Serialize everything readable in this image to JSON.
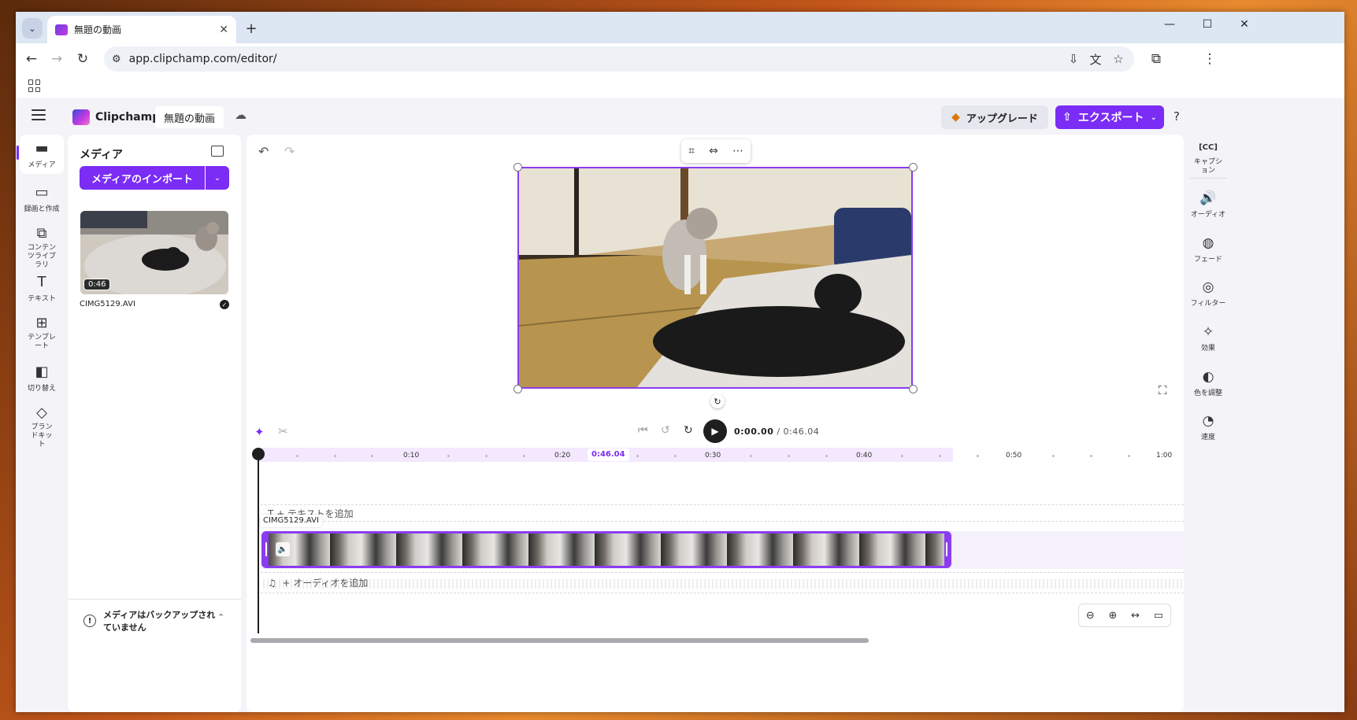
{
  "browser": {
    "tab_title": "無題の動画",
    "url": "app.clipchamp.com/editor/"
  },
  "app": {
    "brand": "Clipchamp",
    "project_name": "無題の動画",
    "upgrade_label": "アップグレード",
    "export_label": "エクスポート"
  },
  "left_rail": [
    {
      "label": "メディア",
      "icon": "folder-icon"
    },
    {
      "label": "録画と作成",
      "icon": "video-camera-icon"
    },
    {
      "label": "コンテンツライブラリ",
      "icon": "library-icon"
    },
    {
      "label": "テキスト",
      "icon": "text-icon"
    },
    {
      "label": "テンプレート",
      "icon": "template-icon"
    },
    {
      "label": "切り替え",
      "icon": "transition-icon"
    },
    {
      "label": "ブランドキット",
      "icon": "brand-kit-icon"
    }
  ],
  "media": {
    "title": "メディア",
    "import_label": "メディアのインポート",
    "item": {
      "duration": "0:46",
      "filename": "CIMG5129.AVI"
    },
    "backup_text": "メディアはバックアップされていません"
  },
  "player": {
    "current_time": "0:00.00",
    "total_time": "/ 0:46.04"
  },
  "timeline": {
    "ticks": [
      "0:10",
      "0:20",
      "0:30",
      "0:40",
      "0:50",
      "1:00"
    ],
    "current_marker": "0:46.04",
    "text_track_label": "T + テキストを追加",
    "clip_label": "CIMG5129.AVI",
    "audio_track_label": "+ オーディオを追加"
  },
  "right_rail": [
    {
      "label": "キャプション",
      "icon": "captions-icon"
    },
    {
      "label": "オーディオ",
      "icon": "speaker-icon"
    },
    {
      "label": "フェード",
      "icon": "fade-icon"
    },
    {
      "label": "フィルター",
      "icon": "filter-icon"
    },
    {
      "label": "効果",
      "icon": "magic-wand-icon"
    },
    {
      "label": "色を調整",
      "icon": "contrast-icon"
    },
    {
      "label": "速度",
      "icon": "speedometer-icon"
    }
  ],
  "colors": {
    "accent": "#7b2cf5",
    "selection": "#8b3cf0"
  }
}
